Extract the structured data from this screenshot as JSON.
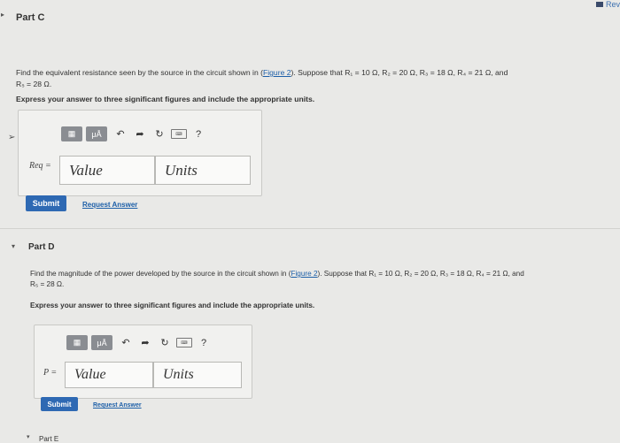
{
  "corner_link": "Rev",
  "part_c": {
    "title": "Part C",
    "problem_line1_pre": "Find the equivalent resistance seen by the source in the circuit shown in (",
    "figure_link": "Figure 2",
    "problem_line1_post": "). Suppose that R₁ = 10 Ω, R₂ = 20 Ω, R₃ = 18 Ω, R₄ = 21 Ω, and",
    "problem_line2": "R₅ = 28 Ω.",
    "instructions": "Express your answer to three significant figures and include the appropriate units.",
    "answer_label": "Req =",
    "value_placeholder": "Value",
    "units_placeholder": "Units",
    "submit_label": "Submit",
    "request_answer_label": "Request Answer"
  },
  "part_d": {
    "title": "Part D",
    "problem_line1_pre": "Find the magnitude of the power developed by the source in the circuit shown in (",
    "figure_link": "Figure 2",
    "problem_line1_post": "). Suppose that R₁ = 10 Ω, R₂ = 20 Ω, R₃ = 18 Ω, R₄ = 21 Ω, and",
    "problem_line2": "R₅ = 28 Ω.",
    "instructions": "Express your answer to three significant figures and include the appropriate units.",
    "answer_label": "P =",
    "value_placeholder": "Value",
    "units_placeholder": "Units",
    "submit_label": "Submit",
    "request_answer_label": "Request Answer"
  },
  "toolbar": {
    "templates_icon": "templates-icon",
    "units_button_label": "μÅ",
    "undo_icon": "undo-icon",
    "redo_icon": "redo-icon",
    "reset_icon": "reset-icon",
    "keyboard_icon": "keyboard-icon",
    "help_label": "?"
  },
  "part_e_partial": "Part E"
}
